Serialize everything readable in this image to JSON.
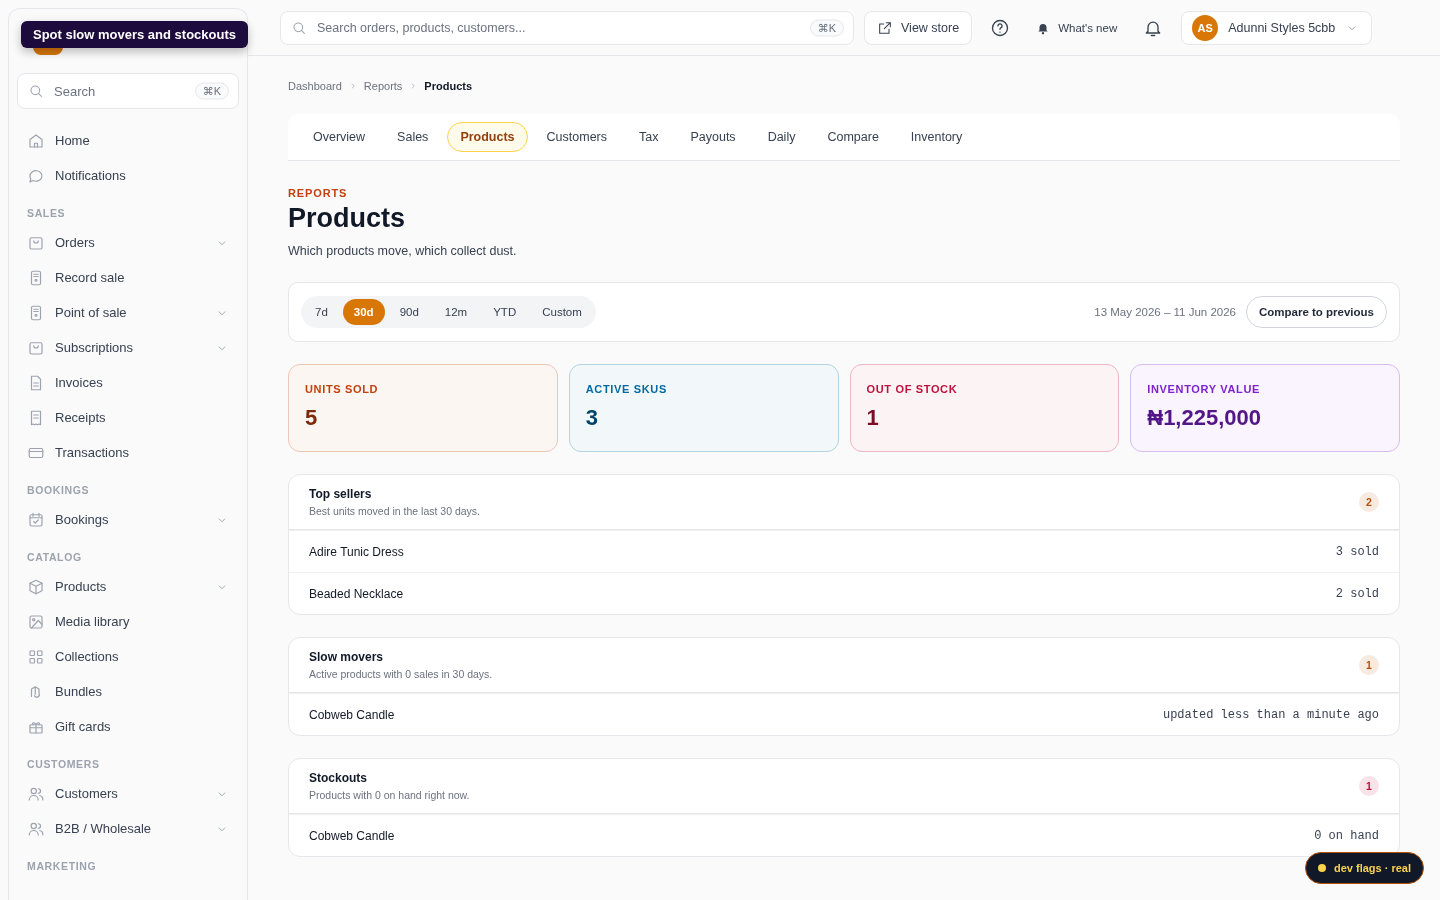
{
  "tooltip": "Spot slow movers and stockouts",
  "sidebar": {
    "search": {
      "placeholder": "Search",
      "shortcut": "⌘K"
    },
    "top_items": [
      {
        "label": "Home",
        "expandable": false
      },
      {
        "label": "Notifications",
        "expandable": false
      }
    ],
    "sections": [
      {
        "title": "SALES",
        "items": [
          {
            "label": "Orders",
            "expandable": true
          },
          {
            "label": "Record sale",
            "expandable": false
          },
          {
            "label": "Point of sale",
            "expandable": true
          },
          {
            "label": "Subscriptions",
            "expandable": true
          },
          {
            "label": "Invoices",
            "expandable": false
          },
          {
            "label": "Receipts",
            "expandable": false
          },
          {
            "label": "Transactions",
            "expandable": false
          }
        ]
      },
      {
        "title": "BOOKINGS",
        "items": [
          {
            "label": "Bookings",
            "expandable": true
          }
        ]
      },
      {
        "title": "CATALOG",
        "items": [
          {
            "label": "Products",
            "expandable": true
          },
          {
            "label": "Media library",
            "expandable": false
          },
          {
            "label": "Collections",
            "expandable": false
          },
          {
            "label": "Bundles",
            "expandable": false
          },
          {
            "label": "Gift cards",
            "expandable": false
          }
        ]
      },
      {
        "title": "CUSTOMERS",
        "items": [
          {
            "label": "Customers",
            "expandable": true
          },
          {
            "label": "B2B / Wholesale",
            "expandable": true
          }
        ]
      },
      {
        "title": "MARKETING"
      }
    ]
  },
  "topbar": {
    "search": {
      "placeholder": "Search orders, products, customers...",
      "shortcut": "⌘K"
    },
    "view_store": "View store",
    "whats_new": "What's new",
    "account": {
      "initials": "AS",
      "name": "Adunni Styles 5cbb"
    }
  },
  "breadcrumb": [
    "Dashboard",
    "Reports",
    "Products"
  ],
  "tabs": [
    {
      "label": "Overview",
      "selected": false
    },
    {
      "label": "Sales",
      "selected": false
    },
    {
      "label": "Products",
      "selected": true
    },
    {
      "label": "Customers",
      "selected": false
    },
    {
      "label": "Tax",
      "selected": false
    },
    {
      "label": "Payouts",
      "selected": false
    },
    {
      "label": "Daily",
      "selected": false
    },
    {
      "label": "Compare",
      "selected": false
    },
    {
      "label": "Inventory",
      "selected": false
    }
  ],
  "header": {
    "eyebrow": "REPORTS",
    "title": "Products",
    "subtitle": "Which products move, which collect dust."
  },
  "ranges": [
    {
      "label": "7d",
      "selected": false
    },
    {
      "label": "30d",
      "selected": true
    },
    {
      "label": "90d",
      "selected": false
    },
    {
      "label": "12m",
      "selected": false
    },
    {
      "label": "YTD",
      "selected": false
    },
    {
      "label": "Custom",
      "selected": false
    }
  ],
  "date_range": "13 May 2026 – 11 Jun 2026",
  "compare_button": "Compare to previous",
  "stats": [
    {
      "label": "UNITS SOLD",
      "value": "5",
      "color": "#c2410c"
    },
    {
      "label": "ACTIVE SKUS",
      "value": "3",
      "color": "#0369a1"
    },
    {
      "label": "OUT OF STOCK",
      "value": "1",
      "color": "#be123c"
    },
    {
      "label": "INVENTORY VALUE",
      "value": "₦1,225,000",
      "color": "#7e22ce"
    }
  ],
  "panels": [
    {
      "title": "Top sellers",
      "subtitle": "Best units moved in the last 30 days.",
      "count": "2",
      "color": "#b45309",
      "rows": [
        {
          "name": "Adire Tunic Dress",
          "value": "3 sold"
        },
        {
          "name": "Beaded Necklace",
          "value": "2 sold"
        }
      ]
    },
    {
      "title": "Slow movers",
      "subtitle": "Active products with 0 sales in 30 days.",
      "count": "1",
      "color": "#b45309",
      "rows": [
        {
          "name": "Cobweb Candle",
          "value": "updated less than a minute ago"
        }
      ]
    },
    {
      "title": "Stockouts",
      "subtitle": "Products with 0 on hand right now.",
      "count": "1",
      "color": "#be123c",
      "rows": [
        {
          "name": "Cobweb Candle",
          "value": "0 on hand"
        }
      ]
    }
  ],
  "dev_badge": "dev flags · real"
}
